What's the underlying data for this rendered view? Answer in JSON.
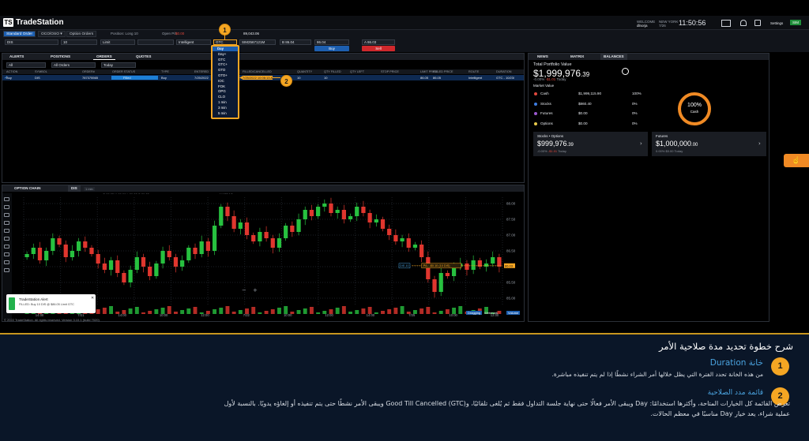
{
  "app": {
    "brand": "TradeStation",
    "welcome_label": "WELCOME",
    "user": "dlnorja",
    "clock_city": "NEW YORK",
    "clock_date": "7/26",
    "clock": "11:50:56",
    "settings": "Settings",
    "sim": "SIM"
  },
  "order_bar": {
    "tabs": [
      "Standard Order",
      "OCO/OSO ▾",
      "Option Orders"
    ],
    "position_label": "Position: Long 10",
    "openpl_label": "Open P/L",
    "openpl_value": "$0.00",
    "symbol": "DIS",
    "quantity": "10",
    "order_type": "Limit",
    "limit_price": "",
    "route": "Intelligent",
    "duration": "GTC",
    "account": "SIM2567121M",
    "bid_label": "B",
    "bid": "86.04",
    "ask_label": "A",
    "ask": "86.03",
    "buy": "Buy",
    "sell": "Sell",
    "bp_value": "89,043.06"
  },
  "duration_menu": {
    "items": [
      "Day",
      "Day+",
      "GTC",
      "GTC+",
      "GTD",
      "GTD+",
      "IOC",
      "FOK",
      "OPG",
      "CLO",
      "1 min",
      "3 min",
      "5 min"
    ]
  },
  "orders_panel": {
    "tabs": [
      "ALERTS",
      "POSITIONS",
      "ORDERS",
      "QUOTES"
    ],
    "filters": [
      "All",
      "All Orders",
      "Today"
    ],
    "columns": [
      "ACTION",
      "SYMBOL",
      "ORDER#",
      "ORDER STATUS",
      "TYPE",
      "ENTERED",
      "FILLED/CANCELLED",
      "QUANTITY",
      "QTY FILLED",
      "QTY LEFT",
      "STOP PRICE",
      "LIMIT PRICE",
      "FILLED PRICE",
      "ROUTE",
      "DURATION"
    ],
    "row": [
      "Buy",
      "DIS",
      "787375565",
      "Filled",
      "Buy",
      "7/25/2022",
      "7/25/2022 10:06:13 A",
      "10",
      "10",
      "",
      "",
      "86.05",
      "86.05",
      "Intelligent",
      "GTC - 10/23/"
    ]
  },
  "right_panel": {
    "tabs": [
      "NEWS",
      "MATRIX",
      "BALANCES"
    ],
    "portfolio_label": "Total Portfolio Value",
    "portfolio_value": "$1,999,976",
    "portfolio_cents": ".39",
    "change_pct": "-0.00%",
    "change_val": "-$1.01",
    "change_when": "Today",
    "market_value_label": "Market Value",
    "donut_pct": "100%",
    "donut_label": "Cash",
    "rows": [
      {
        "name": "Cash",
        "value": "$1,999,115.90",
        "pct": "100%",
        "color": "#e0483c"
      },
      {
        "name": "Stocks",
        "value": "$860.40",
        "pct": "0%",
        "color": "#3d7ce0"
      },
      {
        "name": "Futures",
        "value": "$0.00",
        "pct": "0%",
        "color": "#9b59d0"
      },
      {
        "name": "Options",
        "value": "$0.00",
        "pct": "0%",
        "color": "#e6c84a"
      }
    ],
    "card1": {
      "title": "Stocks • Options",
      "value": "$999,976",
      "cents": ".39",
      "pct": "-0.00%",
      "chg": "-$1.01",
      "when": "Today"
    },
    "card2": {
      "title": "Futures",
      "value": "$1,000,000",
      "cents": ".00",
      "pct": "0.00%",
      "chg": "$0.00",
      "when": "Today"
    }
  },
  "chart_panel": {
    "tabs": [
      "OPTION CHAIN",
      "DIS"
    ],
    "interval": "1 min",
    "quote": "O 86.05 H 86.06 L 86.03 C 86.03",
    "exchange": "NASDAQ",
    "volume": "Vol Up 5376  Vol Down 4076",
    "y_ticks": [
      "88.00",
      "87.50",
      "87.00",
      "86.50",
      "86.00",
      "85.50",
      "85.00"
    ],
    "x_ticks": [
      "14:00",
      "7/21",
      "14:00",
      "10:00",
      "12:00",
      "7/22",
      "10:00",
      "12:00",
      "14:00",
      "7/25",
      "10:00",
      "12:00"
    ],
    "last_price": "86.03",
    "position_tag": "P/L: -$0.10 (10 DIS)",
    "order_tag": "DIS 10",
    "bottom": [
      "Dragging",
      "Webmark",
      "Volume"
    ]
  },
  "alert": {
    "title": "TradeStation Alert",
    "text": "FILLED: Buy 10 DIS @ $86.05 Limit GTC"
  },
  "footer": {
    "copyright": "© 2022 TradeStation. All rights reserved.   Version 3.10.1 (build 7020)"
  },
  "explain": {
    "title": "شرح خطوة تحديد مدة صلاحية الأمر",
    "items": [
      {
        "n": "1",
        "head": "خانة Duration",
        "body": "من هذه الخانة تحدد الفترة التي يظل خلالها أمر الشراء نشطًا إذا لم يتم تنفيذه مباشرة."
      },
      {
        "n": "2",
        "head": "قائمة مدد الصلاحية",
        "body": "تعرض القائمة كل الخيارات المتاحة، وأكثرها استخدامًا: Day ويبقى الأمر فعالًا حتى نهاية جلسة التداول فقط ثم يُلغى تلقائيًا، وGood Till Cancelled (GTC) ويبقى الأمر نشطًا حتى يتم تنفيذه أو إلغاؤه يدويًا. بالنسبة لأول",
        "body2": "عملية شراء، يعد خيار Day مناسبًا في معظم الحالات."
      }
    ]
  },
  "chart_data": {
    "type": "candlestick",
    "symbol": "DIS",
    "interval": "1 min",
    "ylim": [
      84.8,
      88.2
    ],
    "closes": [
      86.4,
      86.6,
      86.2,
      86.5,
      86.9,
      86.7,
      86.3,
      86.5,
      86.8,
      86.6,
      86.4,
      86.1,
      85.9,
      86.2,
      85.8,
      85.5,
      85.9,
      86.3,
      86.0,
      85.7,
      86.1,
      86.5,
      86.3,
      86.0,
      86.2,
      86.6,
      86.4,
      86.8,
      86.5,
      87.3,
      87.9,
      87.6,
      87.2,
      87.4,
      87.0,
      86.8,
      87.1,
      86.9,
      86.6,
      86.9,
      87.3,
      87.1,
      87.5,
      87.8,
      87.6,
      87.9,
      88.0,
      87.7,
      87.8,
      87.5,
      87.6,
      87.9,
      87.7,
      87.4,
      87.5,
      87.2,
      87.0,
      86.8,
      86.9,
      86.6,
      86.7,
      86.3,
      85.6,
      85.2,
      85.8,
      85.7,
      86.0,
      86.1,
      85.9,
      86.2,
      86.0,
      86.1,
      86.3,
      86.0
    ]
  }
}
